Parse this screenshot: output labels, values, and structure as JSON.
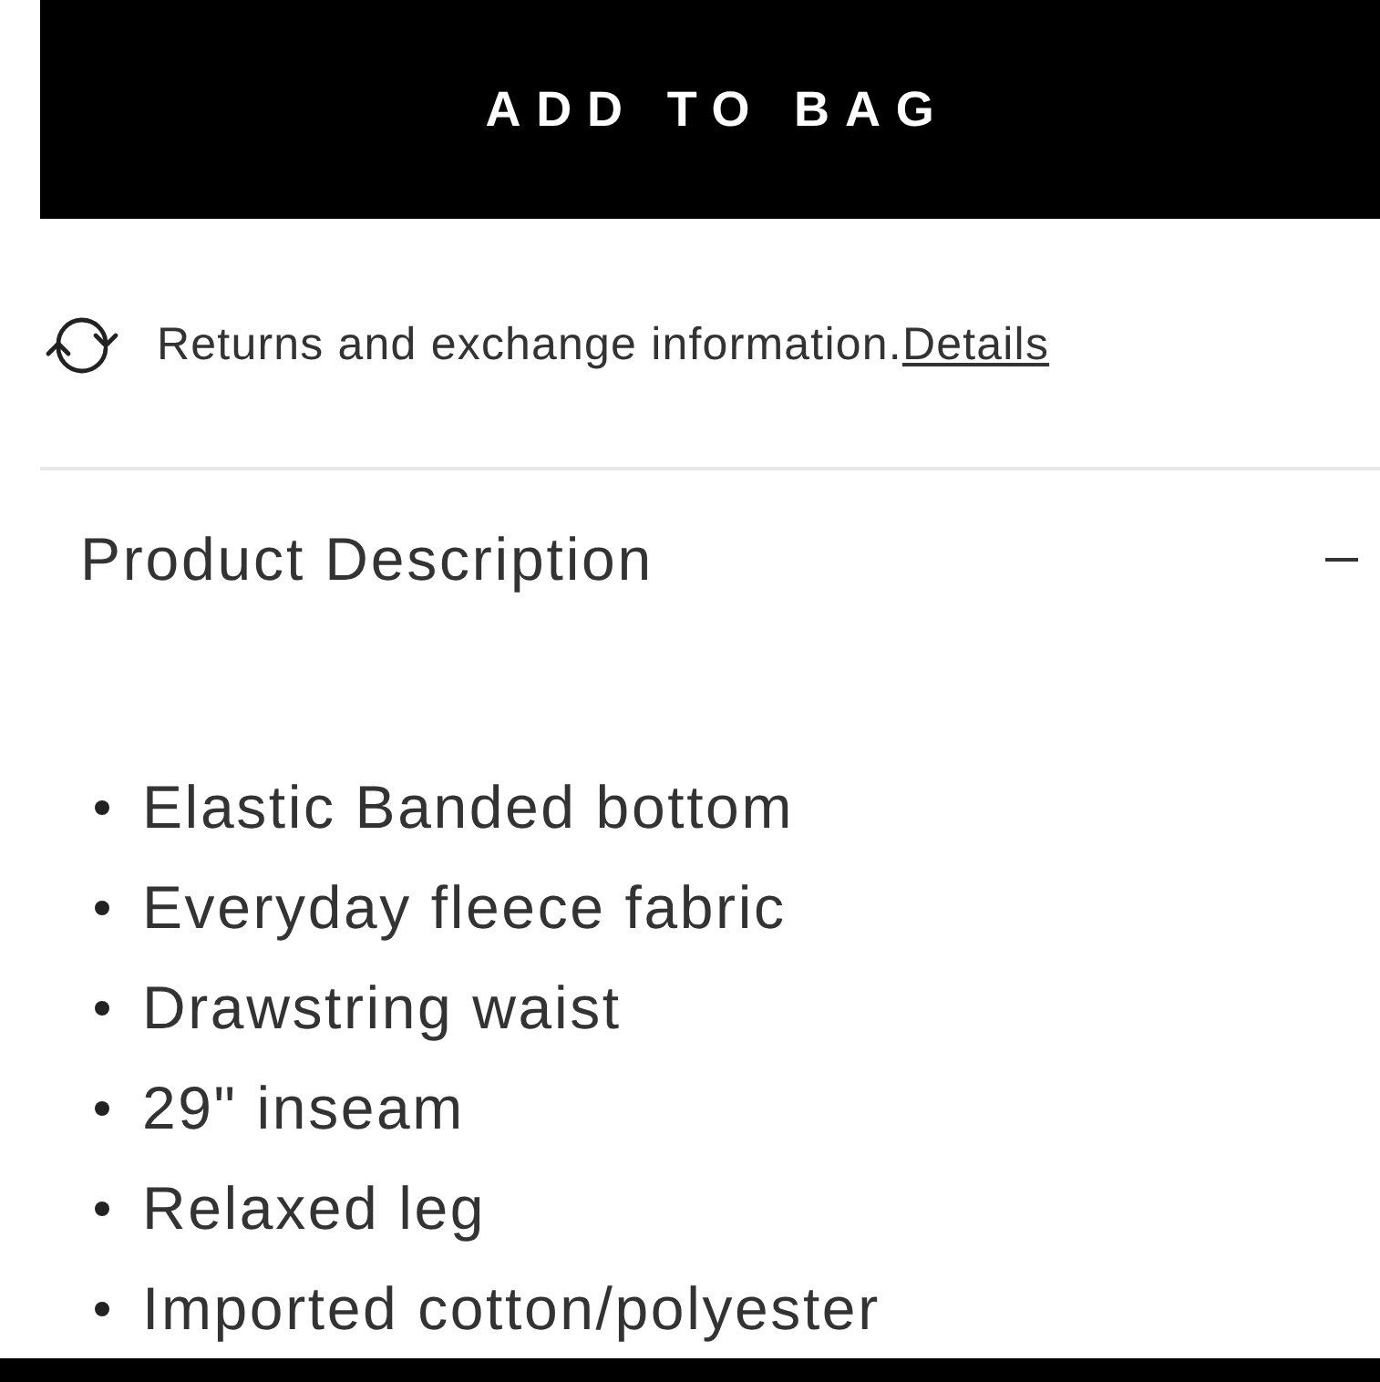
{
  "add_to_bag_button": {
    "label": "ADD TO BAG"
  },
  "returns_info": {
    "text": "Returns and exchange information.",
    "link": "Details"
  },
  "product_description": {
    "title": "Product Description",
    "expanded": true,
    "features": [
      "Elastic Banded bottom",
      "Everyday fleece fabric",
      "Drawstring waist",
      "29\" inseam",
      "Relaxed leg",
      "Imported cotton/polyester"
    ]
  }
}
